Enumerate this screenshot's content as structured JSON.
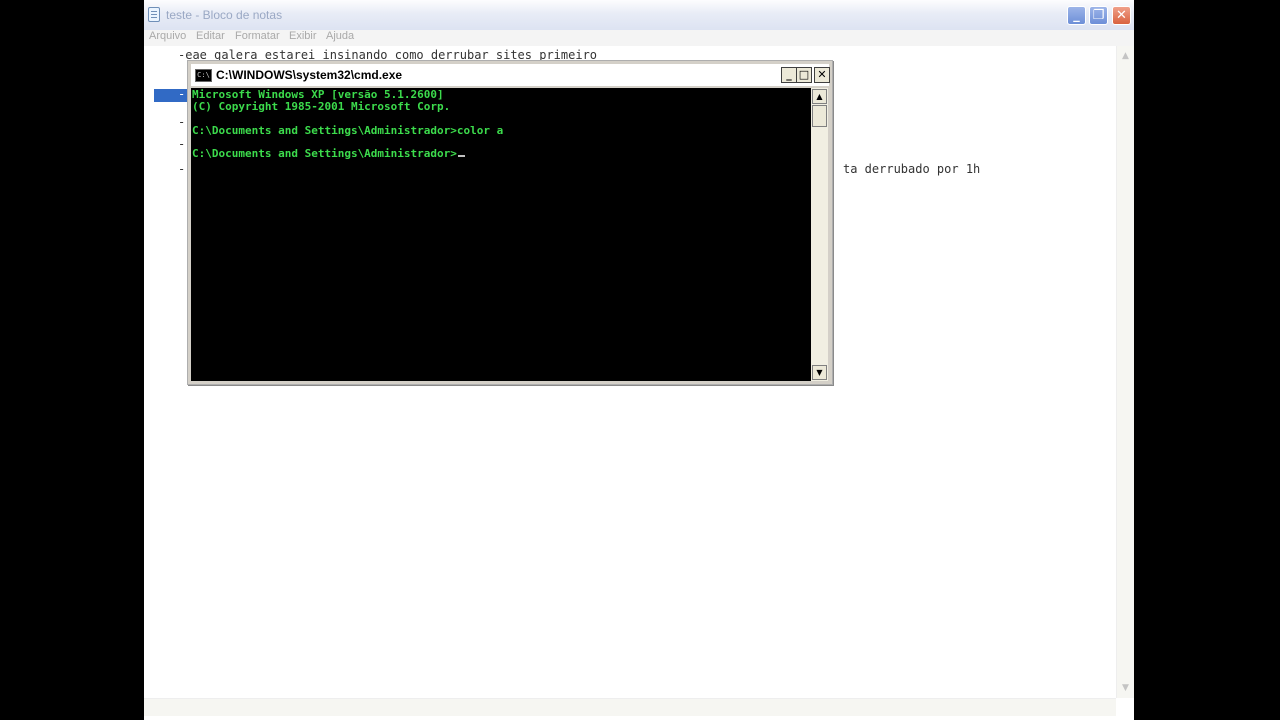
{
  "notepad": {
    "title": "teste - Bloco de notas",
    "menu": [
      "Arquivo",
      "Editar",
      "Formatar",
      "Exibir",
      "Ajuda"
    ],
    "lines": {
      "line1": "-eae galera estarei insinando como derrubar sites primeiro",
      "line4_visible": "ta derrubado por 1h"
    },
    "dashes": [
      "-",
      "-",
      "-",
      "-"
    ]
  },
  "cmd": {
    "title": "C:\\WINDOWS\\system32\\cmd.exe",
    "icon_text": "C:\\",
    "console_lines": [
      "Microsoft Windows XP [versão 5.1.2600]",
      "(C) Copyright 1985-2001 Microsoft Corp.",
      "C:\\Documents and Settings\\Administrador>color a",
      "C:\\Documents and Settings\\Administrador>"
    ],
    "text_color": "#3cdb4c"
  },
  "icons": [
    "notepad-icon",
    "minimize-icon",
    "restore-icon",
    "close-icon",
    "cmd-icon",
    "scroll-up-icon",
    "scroll-down-icon"
  ]
}
